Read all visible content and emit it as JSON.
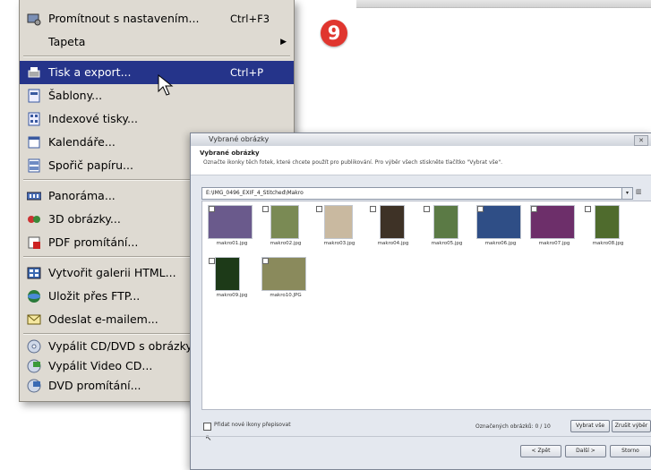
{
  "step_badge": "9",
  "menu": {
    "items": [
      {
        "label": "Promítnout s nastavením...",
        "shortcut": "Ctrl+F3",
        "icon": "slideshow-settings-icon"
      },
      {
        "label": "Tapeta",
        "submenu": "▶",
        "icon": ""
      },
      {
        "label": "Tisk a export...",
        "shortcut": "Ctrl+P",
        "icon": "print-export-icon",
        "active": true
      },
      {
        "label": "Šablony...",
        "icon": "templates-icon"
      },
      {
        "label": "Indexové tisky...",
        "icon": "index-print-icon"
      },
      {
        "label": "Kalendáře...",
        "icon": "calendar-icon"
      },
      {
        "label": "Spořič papíru...",
        "icon": "paper-saver-icon"
      },
      {
        "label": "Panoráma...",
        "icon": "panorama-icon"
      },
      {
        "label": "3D obrázky...",
        "icon": "3d-images-icon"
      },
      {
        "label": "PDF promítání...",
        "icon": "pdf-slideshow-icon"
      },
      {
        "label": "Vytvořit galerii HTML...",
        "icon": "html-gallery-icon"
      },
      {
        "label": "Uložit přes FTP...",
        "icon": "ftp-upload-icon"
      },
      {
        "label": "Odeslat e-mailem...",
        "icon": "email-icon"
      },
      {
        "label": "Vypálit CD/DVD s obrázky...",
        "icon": "burn-cd-icon"
      },
      {
        "label": "Vypálit Video CD...",
        "icon": "video-cd-icon"
      },
      {
        "label": "DVD promítání...",
        "icon": "dvd-slideshow-icon"
      }
    ]
  },
  "dialog": {
    "title": "Vybrané obrázky",
    "heading": "Vybrané obrázky",
    "instruction": "Označte ikonky těch fotek, které chcete použít pro publikování. Pro výběr všech stiskněte tlačítko \"Vybrat vše\".",
    "path": "E:\\IMG_0496_EXIF_4_Stitched\\Makro",
    "thumbnails": [
      {
        "name": "makro01.jpg",
        "color": "#6a5a8c"
      },
      {
        "name": "makro02.jpg",
        "color": "#7a8a54"
      },
      {
        "name": "makro03.jpg",
        "color": "#c9b9a0"
      },
      {
        "name": "makro04.jpg",
        "color": "#3e3226"
      },
      {
        "name": "makro05.jpg",
        "color": "#5b7a45"
      },
      {
        "name": "makro06.jpg",
        "color": "#2f4e86"
      },
      {
        "name": "makro07.jpg",
        "color": "#6d2f6a"
      },
      {
        "name": "makro08.jpg",
        "color": "#4f6b2d"
      },
      {
        "name": "makro09.jpg",
        "color": "#1d3a18"
      },
      {
        "name": "makro10.JPG",
        "color": "#8a8a5c"
      }
    ],
    "option_label": "Přidat nové ikony přepisovat",
    "count_label": "Označených obrázků: 0 / 10",
    "buttons": {
      "select_all": "Vybrat vše",
      "deselect_all": "Zrušit výběr",
      "prev": "< Zpět",
      "next": "Další >",
      "cancel": "Storno"
    }
  }
}
